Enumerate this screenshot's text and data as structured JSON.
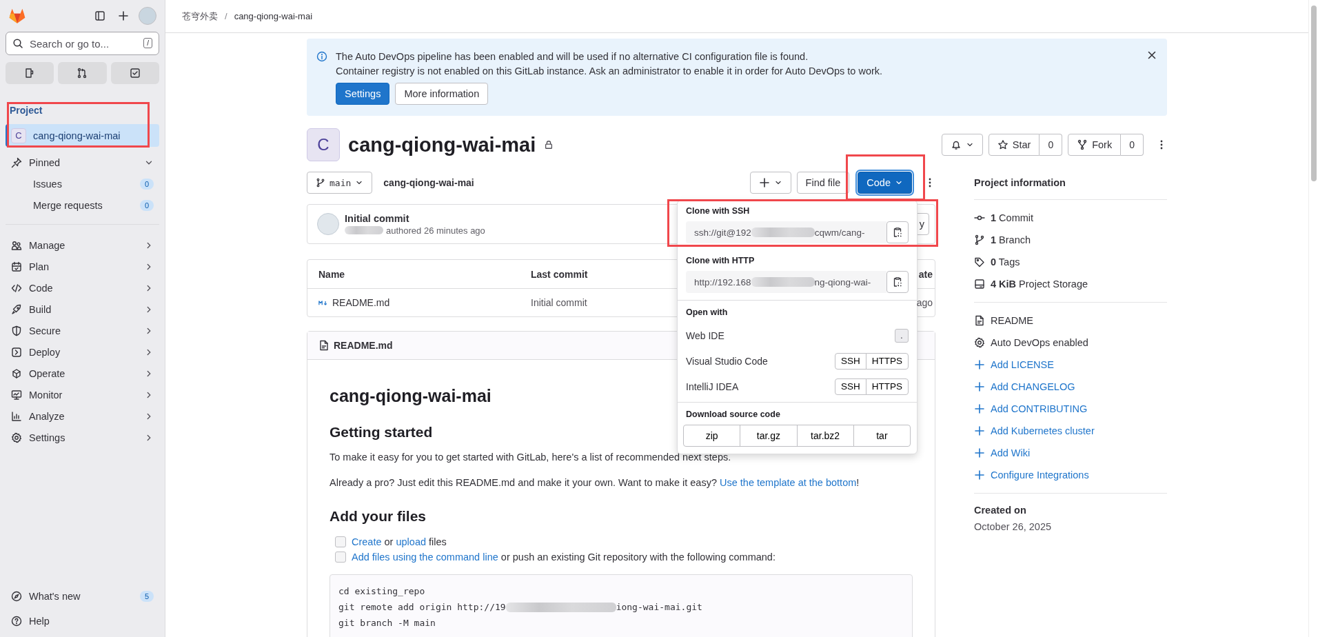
{
  "breadcrumb": {
    "items": [
      "苍穹外卖",
      "cang-qiong-wai-mai"
    ],
    "separator": "/"
  },
  "sidebar": {
    "search": {
      "placeholder": "Search or go to...",
      "shortcut": "/"
    },
    "section_title": "Project",
    "project": {
      "avatar": "C",
      "name": "cang-qiong-wai-mai",
      "selected": true
    },
    "pinned": {
      "label": "Pinned",
      "expanded": true,
      "items": [
        {
          "label": "Issues",
          "count": "0",
          "selected": false
        },
        {
          "label": "Merge requests",
          "count": "0",
          "selected": false
        }
      ]
    },
    "nav": [
      {
        "label": "Manage",
        "selected": false
      },
      {
        "label": "Plan",
        "selected": false
      },
      {
        "label": "Code",
        "selected": false
      },
      {
        "label": "Build",
        "selected": false
      },
      {
        "label": "Secure",
        "selected": false
      },
      {
        "label": "Deploy",
        "selected": false
      },
      {
        "label": "Operate",
        "selected": false
      },
      {
        "label": "Monitor",
        "selected": false
      },
      {
        "label": "Analyze",
        "selected": false
      },
      {
        "label": "Settings",
        "selected": false
      }
    ],
    "footer": [
      {
        "label": "What's new",
        "count": "5"
      },
      {
        "label": "Help"
      }
    ]
  },
  "alert": {
    "lines": [
      "The Auto DevOps pipeline has been enabled and will be used if no alternative CI configuration file is found.",
      "Container registry is not enabled on this GitLab instance. Ask an administrator to enable it in order for Auto DevOps to work."
    ],
    "buttons": [
      {
        "label": "Settings",
        "kind": "primary"
      },
      {
        "label": "More information",
        "kind": "default"
      }
    ]
  },
  "project": {
    "avatar": "C",
    "title": "cang-qiong-wai-mai",
    "star": {
      "label": "Star",
      "count": "0"
    },
    "fork": {
      "label": "Fork",
      "count": "0"
    }
  },
  "toolbar": {
    "branch": "main",
    "path": "cang-qiong-wai-mai",
    "find_file": "Find file",
    "code": "Code"
  },
  "commit": {
    "title": "Initial commit",
    "meta": "authored 26 minutes ago",
    "button_visible_text": "y"
  },
  "file_table": {
    "columns": [
      "Name",
      "Last commit",
      "ate"
    ],
    "rows": [
      {
        "name": "README.md",
        "last_commit": "Initial commit",
        "column_3": "ago"
      }
    ]
  },
  "readme": {
    "file_name": "README.md",
    "title": "cang-qiong-wai-mai",
    "heading_1": "Getting started",
    "intro": "To make it easy for you to get started with GitLab, here's a list of recommended next steps.",
    "pro_tip": [
      {
        "kind": "text",
        "text": "Already a pro? Just edit this README.md and make it your own. Want to make it easy? "
      },
      {
        "kind": "link",
        "text": "Use the template at the bottom"
      },
      {
        "kind": "text",
        "text": "!"
      }
    ],
    "heading_2": "Add your files",
    "checklist": [
      {
        "checked": false,
        "parts": [
          {
            "kind": "link",
            "text": "Create"
          },
          {
            "kind": "text",
            "text": " or "
          },
          {
            "kind": "link",
            "text": "upload"
          },
          {
            "kind": "text",
            "text": " files"
          }
        ]
      },
      {
        "checked": false,
        "parts": [
          {
            "kind": "link",
            "text": "Add files using the command line"
          },
          {
            "kind": "text",
            "text": " or push an existing Git repository with the following command:"
          }
        ]
      }
    ],
    "code_lines": [
      [
        "cd existing_repo"
      ],
      [
        "git remote add origin http://19",
        "iong-wai-mai.git"
      ],
      [
        "git branch -M main"
      ]
    ]
  },
  "code_dropdown": {
    "clone": [
      {
        "title": "Clone with SSH",
        "value_parts": [
          "ssh://git@192",
          "cqwm/cang-"
        ]
      },
      {
        "title": "Clone with HTTP",
        "value_parts": [
          "http://192.168",
          "ng-qiong-wai-"
        ]
      }
    ],
    "open_with": {
      "title": "Open with",
      "items": [
        {
          "label": "Web IDE",
          "kind": "shortcut",
          "options": [
            "."
          ]
        },
        {
          "label": "Visual Studio Code",
          "kind": "options",
          "options": [
            "SSH",
            "HTTPS"
          ]
        },
        {
          "label": "IntelliJ IDEA",
          "kind": "options",
          "options": [
            "SSH",
            "HTTPS"
          ]
        }
      ]
    },
    "download": {
      "title": "Download source code",
      "formats": [
        "zip",
        "tar.gz",
        "tar.bz2",
        "tar"
      ]
    }
  },
  "project_info": {
    "title": "Project information",
    "stats": [
      "**1** Commit",
      "**1** Branch",
      "**0** Tags",
      "**4 KiB** Project Storage"
    ],
    "files": [
      "README",
      "Auto DevOps enabled"
    ],
    "actions": [
      "Add LICENSE",
      "Add CHANGELOG",
      "Add CONTRIBUTING",
      "Add Kubernetes cluster",
      "Add Wiki",
      "Configure Integrations"
    ],
    "created_title": "Created on",
    "created_date": "October 26, 2025"
  }
}
